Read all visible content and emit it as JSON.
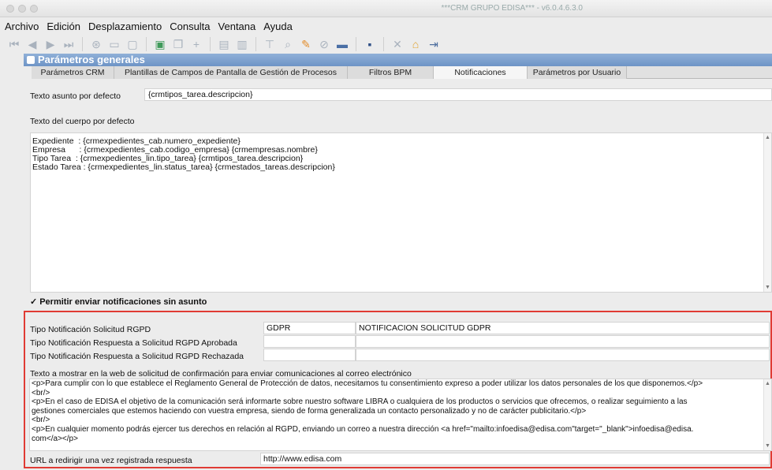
{
  "window": {
    "title": "***CRM GRUPO EDISA*** - v6.0.4.6.3.0",
    "header": "Parámetros generales"
  },
  "menu": [
    {
      "label": "Archivo"
    },
    {
      "label": "Edición"
    },
    {
      "label": "Desplazamiento"
    },
    {
      "label": "Consulta"
    },
    {
      "label": "Ventana"
    },
    {
      "label": "Ayuda"
    }
  ],
  "tabs": [
    {
      "label": "Parámetros CRM"
    },
    {
      "label": "Plantillas de Campos de Pantalla de Gestión de Procesos"
    },
    {
      "label": "Filtros BPM"
    },
    {
      "label": "Notificaciones"
    },
    {
      "label": "Parámetros por Usuario"
    }
  ],
  "form": {
    "subject_label": "Texto asunto por defecto",
    "subject_value": "{crmtipos_tarea.descripcion}",
    "body_label": "Texto del cuerpo por defecto",
    "body_lines": [
      "Expediente  : {crmexpedientes_cab.numero_expediente}",
      "Empresa      : {crmexpedientes_cab.codigo_empresa} {crmempresas.nombre}",
      "Tipo Tarea  : {crmexpedientes_lin.tipo_tarea} {crmtipos_tarea.descripcion}",
      "Estado Tarea : {crmexpedientes_lin.status_tarea} {crmestados_tareas.descripcion}"
    ],
    "allow_no_subject_label": "Permitir enviar notificaciones sin asunto",
    "allow_no_subject_checked": true,
    "rgpd_rows": [
      {
        "label": "Tipo Notificación Solicitud RGPD",
        "code": "GDPR",
        "desc": "NOTIFICACION SOLICITUD GDPR"
      },
      {
        "label": "Tipo Notificación Respuesta a Solicitud RGPD Aprobada",
        "code": "",
        "desc": ""
      },
      {
        "label": "Tipo Notificación Respuesta a Solicitud RGPD Rechazada",
        "code": "",
        "desc": ""
      }
    ],
    "web_text_label": "Texto a mostrar en la web de solicitud de confirmación para enviar comunicaciones al correo electrónico",
    "web_text_lines": [
      "<p>Para cumplir con lo que establece el Reglamento General de Protección de datos, necesitamos tu consentimiento expreso a poder utilizar los datos personales de los que disponemos.</p>",
      "<br/>",
      "<p>En el caso de EDISA el objetivo de la comunicación será informarte sobre nuestro software LIBRA o cualquiera de los productos o servicios que ofrecemos, o realizar seguimiento a las",
      "gestiones comerciales que estemos haciendo con vuestra empresa, siendo de forma generalizada un contacto personalizado y no de carácter publicitario.</p>",
      "<br/>",
      "<p>En cualquier momento podrás ejercer tus derechos en relación al RGPD, enviando un correo a nuestra dirección <a href=\"mailto:infoedisa@edisa.com\"target=\"_blank\">infoedisa@edisa.",
      "com</a></p>"
    ],
    "redirect_label": "URL a redirigir una vez registrada respuesta",
    "redirect_value": "http://www.edisa.com"
  },
  "colors": {
    "accent": "#7a9ccc",
    "highlight_border": "#e03b34"
  }
}
